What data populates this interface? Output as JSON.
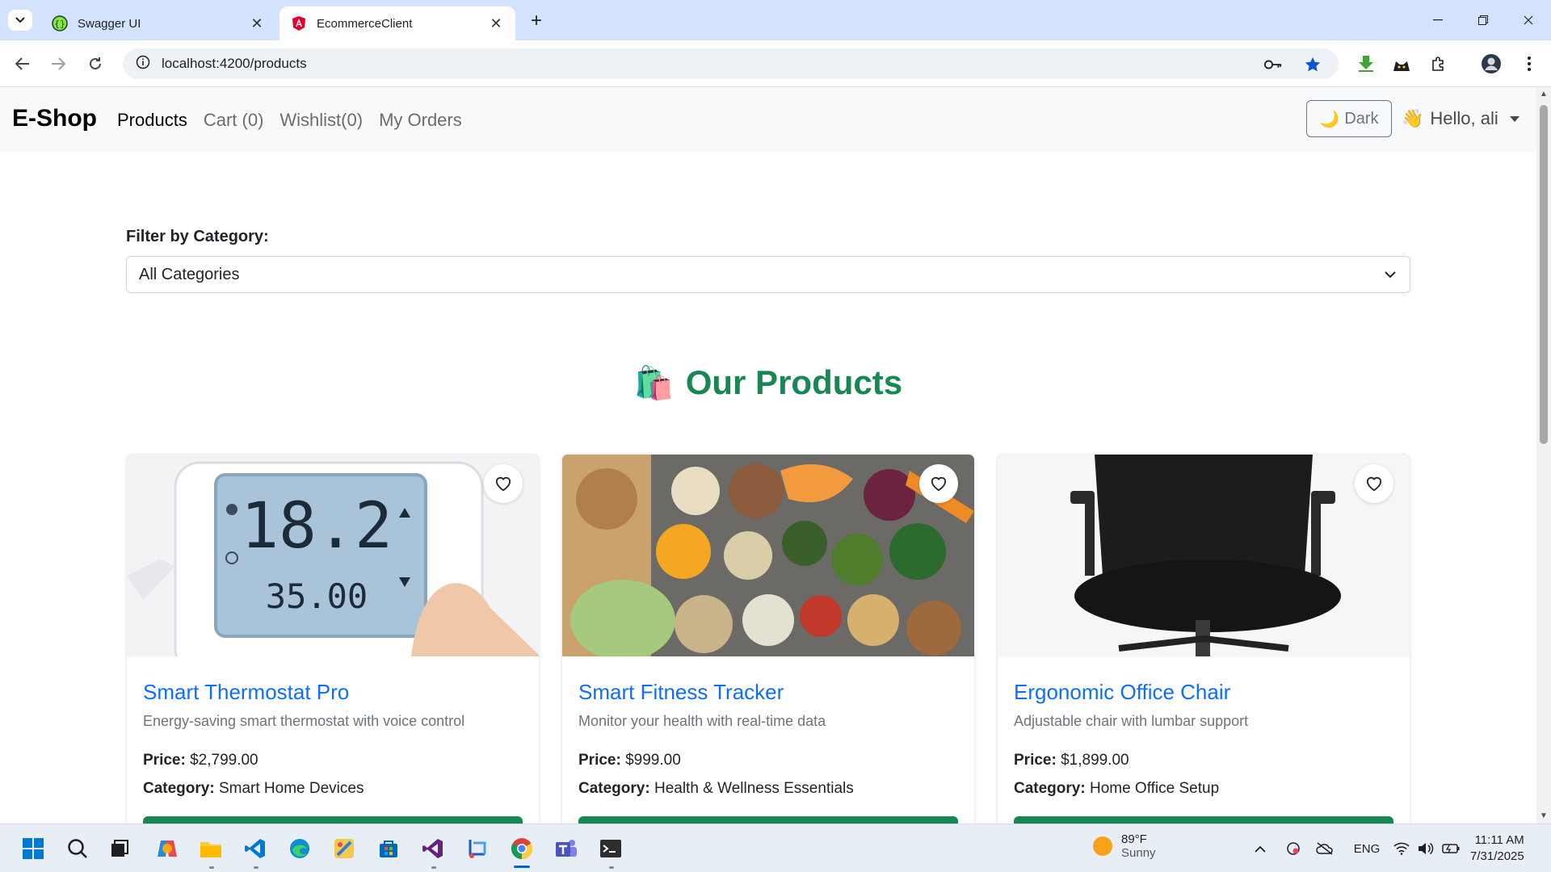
{
  "browser": {
    "tabs": [
      {
        "title": "Swagger UI",
        "icon": "swagger-favicon",
        "active": false
      },
      {
        "title": "EcommerceClient",
        "icon": "angular-favicon",
        "active": true
      }
    ],
    "url": "localhost:4200/products"
  },
  "app": {
    "brand": "E-Shop",
    "nav": [
      "Products",
      "Cart (0)",
      "Wishlist(0)",
      "My Orders"
    ],
    "theme_button": "Dark",
    "theme_icon": "🌙",
    "greeting": "Hello, ali",
    "greeting_icon": "👋"
  },
  "filter": {
    "label": "Filter by Category:",
    "selected": "All Categories"
  },
  "section": {
    "icon": "🛍️",
    "title": "Our Products"
  },
  "products": [
    {
      "name": "Smart Thermostat Pro",
      "description": "Energy-saving smart thermostat with voice control",
      "price_label": "Price:",
      "price": "$2,799.00",
      "category_label": "Category:",
      "category": "Smart Home Devices"
    },
    {
      "name": "Smart Fitness Tracker",
      "description": "Monitor your health with real-time data",
      "price_label": "Price:",
      "price": "$999.00",
      "category_label": "Category:",
      "category": "Health & Wellness Essentials"
    },
    {
      "name": "Ergonomic Office Chair",
      "description": "Adjustable chair with lumbar support",
      "price_label": "Price:",
      "price": "$1,899.00",
      "category_label": "Category:",
      "category": "Home Office Setup"
    }
  ],
  "taskbar": {
    "weather_temp": "89°F",
    "weather_condition": "Sunny",
    "language": "ENG",
    "time": "11:11 AM",
    "date": "7/31/2025"
  },
  "colors": {
    "accent_green": "#198754",
    "link_blue": "#0d6efd",
    "tab_strip": "#d3e3fd"
  }
}
